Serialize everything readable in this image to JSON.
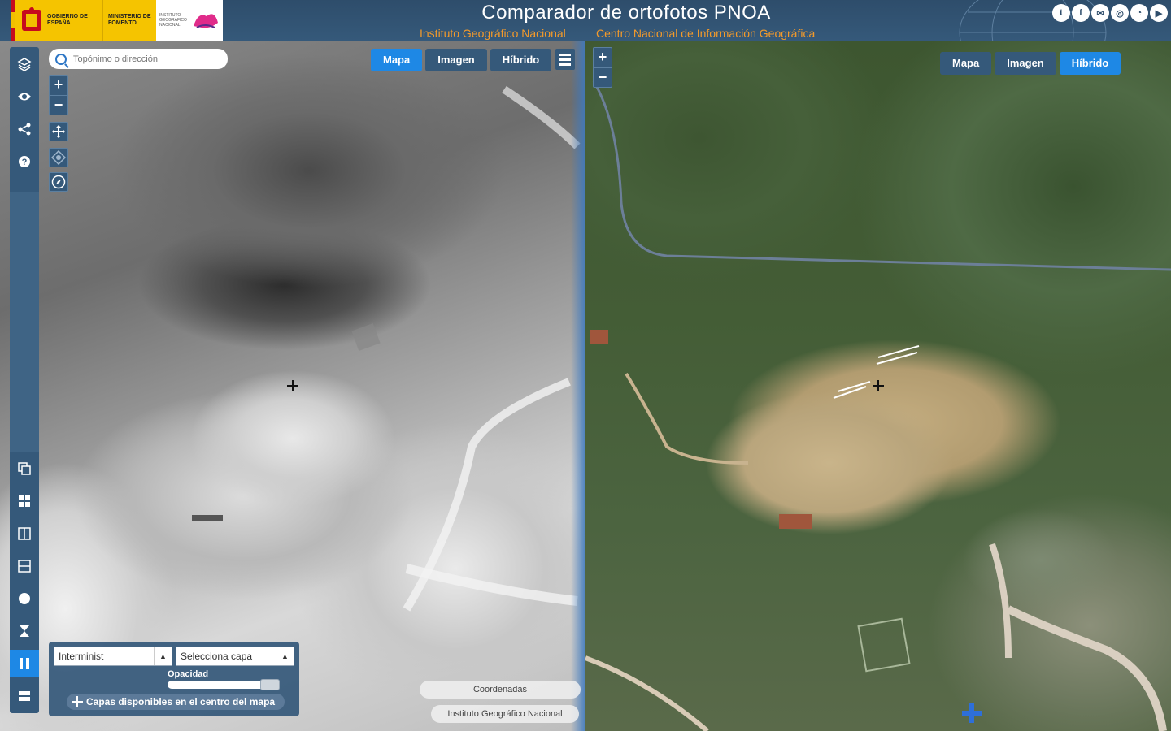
{
  "header": {
    "title": "Comparador de ortofotos PNOA",
    "subtitle_left": "Instituto Geográfico Nacional",
    "subtitle_right": "Centro Nacional de Información Geográfica",
    "logo_gov_text": "GOBIERNO DE ESPAÑA",
    "logo_ministry_text": "MINISTERIO DE FOMENTO",
    "logo_ign_text": "INSTITUTO GEOGRÁFICO NACIONAL",
    "social": [
      {
        "icon": "twitter-icon",
        "glyph": "t"
      },
      {
        "icon": "facebook-icon",
        "glyph": "f"
      },
      {
        "icon": "email-icon",
        "glyph": "✉"
      },
      {
        "icon": "instagram-icon",
        "glyph": "◎"
      },
      {
        "icon": "rss-icon",
        "glyph": "◔"
      },
      {
        "icon": "youtube-icon",
        "glyph": "▶"
      }
    ]
  },
  "search": {
    "placeholder": "Topónimo o dirección"
  },
  "left_map": {
    "layers": [
      "Mapa",
      "Imagen",
      "Híbrido"
    ],
    "active_layer": "Mapa"
  },
  "right_map": {
    "layers": [
      "Mapa",
      "Imagen",
      "Híbrido"
    ],
    "active_layer": "Híbrido"
  },
  "zoom": {
    "in": "+",
    "out": "−"
  },
  "layer_panel": {
    "select_left": "Interminist",
    "select_right": "Selecciona capa",
    "opacity_label": "Opacidad",
    "opacity_value": 1.0,
    "center_button": "Capas disponibles en el centro del mapa"
  },
  "footer": {
    "coordinates": "Coordenadas",
    "attribution": "Instituto Geográfico Nacional"
  },
  "sidebar": {
    "items_top": [
      "layers-icon",
      "eye-icon",
      "share-icon",
      "help-icon"
    ],
    "items_bottom": [
      "copy-icon",
      "grid-icon",
      "split-vertical-icon",
      "split-horizontal-icon",
      "circle-icon",
      "hourglass-icon",
      "columns-icon",
      "rows-icon"
    ],
    "active_item": "columns-icon"
  },
  "colors": {
    "header_bg": "#2e4d6b",
    "accent": "#1e88e5",
    "subtitle": "#f39a2b",
    "panel": "#35597a"
  }
}
